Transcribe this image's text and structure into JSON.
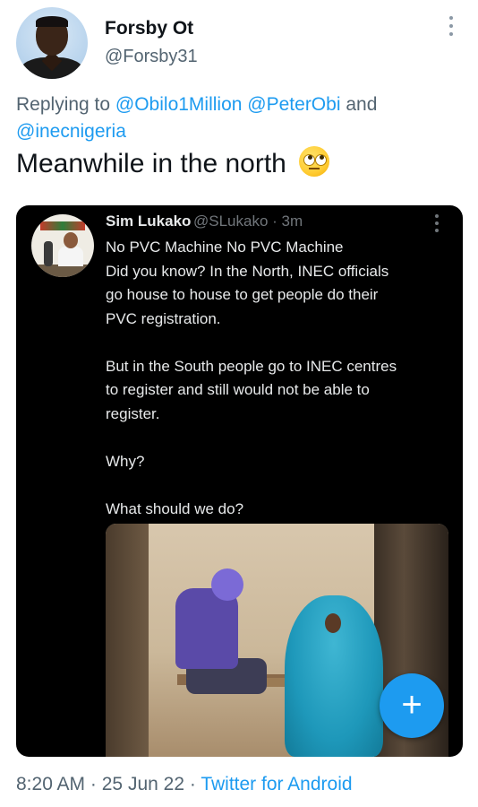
{
  "tweet": {
    "display_name": "Forsby Ot",
    "handle": "@Forsby31",
    "replying_prefix": "Replying to ",
    "reply_mentions": [
      "@Obilo1Million",
      "@PeterObi"
    ],
    "reply_and": " and ",
    "reply_last_mention": "@inecnigeria",
    "text": "Meanwhile in the north",
    "emoji": "face-with-rolling-eyes-emoji",
    "time": "8:20 AM",
    "separator": "·",
    "date": "25 Jun 22",
    "source": "Twitter for Android"
  },
  "quoted": {
    "display_name": "Sim Lukako",
    "handle": "@SLukako",
    "age": "· 3m",
    "paragraphs": [
      [
        "No PVC Machine No PVC Machine",
        "Did you know? In the North, INEC officials",
        "go house to house to get people do their",
        "PVC registration."
      ],
      [
        "But in the South people go to INEC centres",
        "to register and still would not be able to",
        "register."
      ],
      [
        "Why?"
      ],
      [
        "What should we do?"
      ]
    ]
  },
  "fab": {
    "label": "+"
  },
  "colors": {
    "accent": "#1d9bf0",
    "secondary_text": "#536471",
    "card_bg": "#000000"
  }
}
